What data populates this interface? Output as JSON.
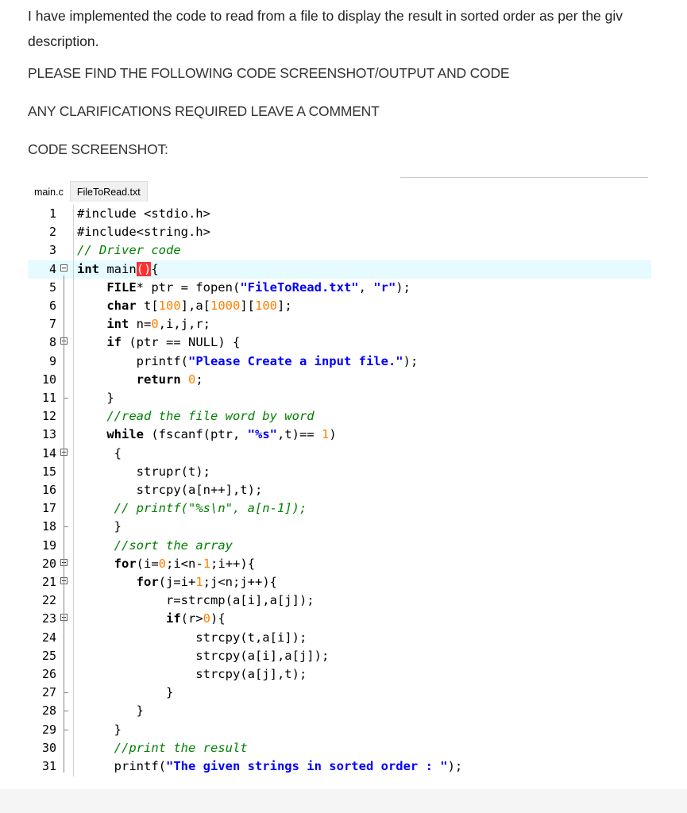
{
  "intro": {
    "line1": "I have implemented the code to read from a file to display the result in sorted order as per the giv",
    "line2": "description."
  },
  "headings": {
    "find": "PLEASE FIND THE FOLLOWING CODE SCREENSHOT/OUTPUT AND CODE",
    "clarify": "ANY CLARIFICATIONS REQUIRED LEAVE A COMMENT",
    "screenshot": "CODE SCREENSHOT:"
  },
  "editor": {
    "tabs": [
      {
        "label": "main.c",
        "active": true
      },
      {
        "label": "FileToRead.txt",
        "active": false
      }
    ],
    "highlight_line": 4,
    "lines": [
      {
        "n": "1",
        "text": "#include <stdio.h>"
      },
      {
        "n": "2",
        "text": "#include<string.h>"
      },
      {
        "n": "3",
        "text": "// Driver code"
      },
      {
        "n": "4",
        "text": "int main(){"
      },
      {
        "n": "5",
        "text": "    FILE* ptr = fopen(\"FileToRead.txt\", \"r\");"
      },
      {
        "n": "6",
        "text": "    char t[100],a[1000][100];"
      },
      {
        "n": "7",
        "text": "    int n=0,i,j,r;"
      },
      {
        "n": "8",
        "text": "    if (ptr == NULL) {"
      },
      {
        "n": "9",
        "text": "        printf(\"Please Create a input file.\");"
      },
      {
        "n": "10",
        "text": "        return 0;"
      },
      {
        "n": "11",
        "text": "    }"
      },
      {
        "n": "12",
        "text": "    //read the file word by word"
      },
      {
        "n": "13",
        "text": "    while (fscanf(ptr, \"%s\",t)== 1)"
      },
      {
        "n": "14",
        "text": "     {"
      },
      {
        "n": "15",
        "text": "        strupr(t);"
      },
      {
        "n": "16",
        "text": "        strcpy(a[n++],t);"
      },
      {
        "n": "17",
        "text": "     // printf(\"%s\\n\", a[n-1]);"
      },
      {
        "n": "18",
        "text": "     }"
      },
      {
        "n": "19",
        "text": "     //sort the array"
      },
      {
        "n": "20",
        "text": "     for(i=0;i<n-1;i++){"
      },
      {
        "n": "21",
        "text": "        for(j=i+1;j<n;j++){"
      },
      {
        "n": "22",
        "text": "            r=strcmp(a[i],a[j]);"
      },
      {
        "n": "23",
        "text": "            if(r>0){"
      },
      {
        "n": "24",
        "text": "                strcpy(t,a[i]);"
      },
      {
        "n": "25",
        "text": "                strcpy(a[i],a[j]);"
      },
      {
        "n": "26",
        "text": "                strcpy(a[j],t);"
      },
      {
        "n": "27",
        "text": "            }"
      },
      {
        "n": "28",
        "text": "        }"
      },
      {
        "n": "29",
        "text": "     }"
      },
      {
        "n": "30",
        "text": "     //print the result"
      },
      {
        "n": "31",
        "text": "     printf(\"The given strings in sorted order : \");"
      }
    ],
    "fold_markers": [
      "4",
      "8",
      "14",
      "20",
      "21",
      "23"
    ]
  }
}
